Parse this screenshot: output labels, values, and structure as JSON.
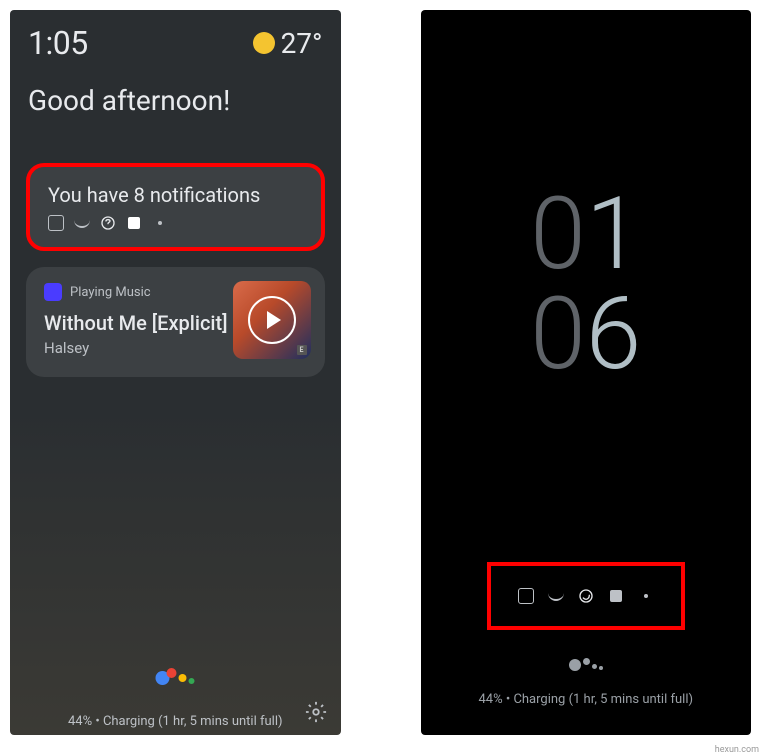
{
  "left": {
    "time": "1:05",
    "temperature": "27°",
    "greeting": "Good afternoon!",
    "notification_card": {
      "title": "You have 8 notifications"
    },
    "media_card": {
      "service_label": "Playing Music",
      "track_title": "Without Me [Explicit]",
      "artist": "Halsey",
      "explicit_badge": "E"
    },
    "charging_status": "44% • Charging (1 hr, 5 mins until full)"
  },
  "right": {
    "hour_tens": "0",
    "hour_ones": "1",
    "minute_tens": "0",
    "minute_ones": "6",
    "charging_status": "44% • Charging (1 hr, 5 mins until full)"
  },
  "watermark": "hexun.com"
}
